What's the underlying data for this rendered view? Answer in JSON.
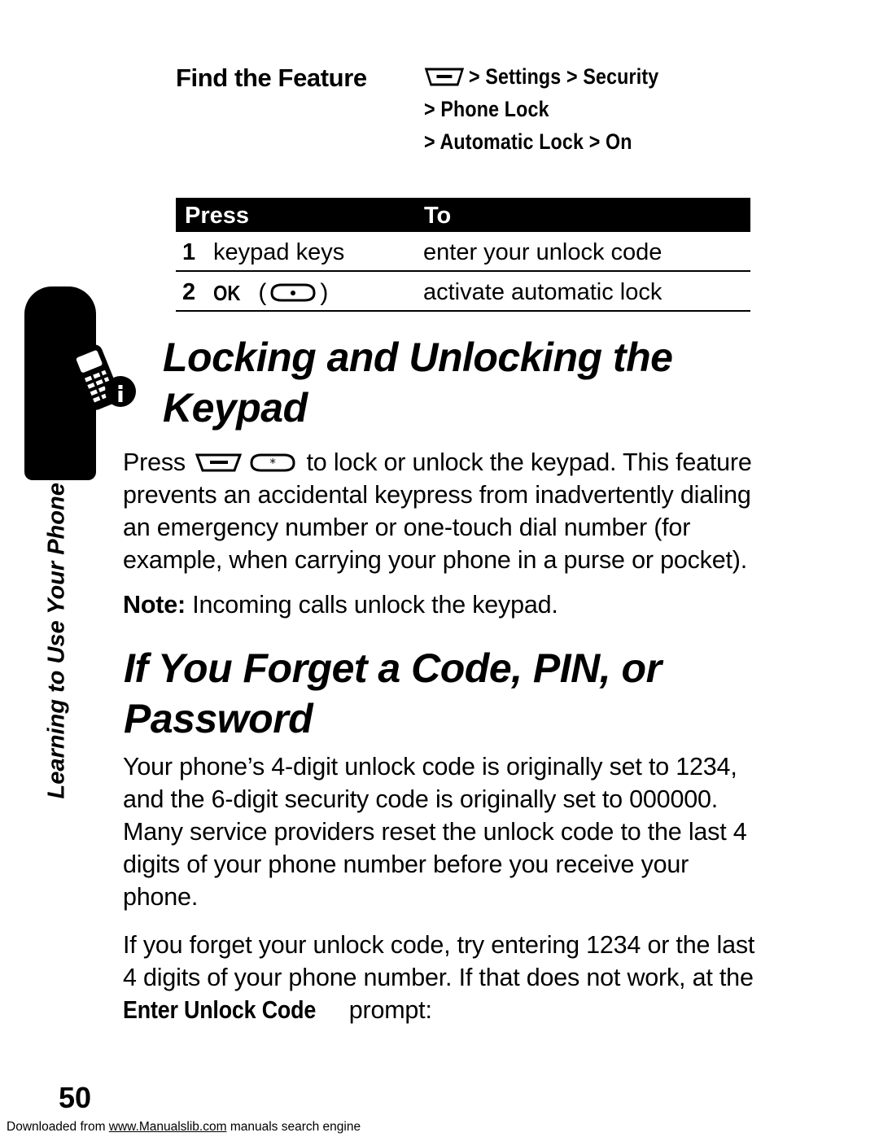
{
  "side_tab": {
    "label": "Learning to Use Your Phone"
  },
  "find_feature": {
    "label": "Find the Feature",
    "menu_icon": "menu-key-icon",
    "path_lines": [
      "> Settings > Security",
      "> Phone Lock",
      "> Automatic Lock > On"
    ]
  },
  "table": {
    "headers": [
      "Press",
      "To"
    ],
    "rows": [
      {
        "num": "1",
        "press": "keypad keys",
        "to": "enter your unlock code",
        "key_icon": null
      },
      {
        "num": "2",
        "press": "OK",
        "to": "activate automatic lock",
        "key_icon": "center-select-key-icon"
      }
    ]
  },
  "sections": [
    {
      "id": "locking",
      "icon": "phone-info-icon",
      "heading": "Locking and Unlocking the Keypad",
      "paragraphs": [
        {
          "id": "press-to-lock",
          "prefix": "Press ",
          "icons": [
            "menu-key-icon",
            "star-key-icon"
          ],
          "text": " to lock or unlock the keypad. This feature prevents an accidental keypress from inadvertently dialing an emergency number or one-touch dial number (for example, when carrying your phone in a purse or pocket)."
        },
        {
          "id": "note",
          "bold_lead": "Note:",
          "text": " Incoming calls unlock the keypad."
        }
      ]
    },
    {
      "id": "forget-code",
      "heading": "If You Forget a Code, PIN, or Password",
      "paragraphs": [
        {
          "id": "codes-default",
          "text": "Your phone’s 4-digit unlock code is originally set to 1234, and the 6-digit security code is originally set to 000000. Many service providers reset the unlock code to the last 4 digits of your phone number before you receive your phone."
        },
        {
          "id": "forget-instructions",
          "text": "If you forget your unlock code, try entering 1234 or the last 4 digits of your phone number. If that does not work, at the ",
          "prompt_label": "Enter Unlock Code",
          "text_after": " prompt:"
        }
      ]
    }
  ],
  "page_number": "50",
  "footer": {
    "prefix": "Downloaded from ",
    "link": "www.Manualslib.com",
    "suffix": " manuals search engine"
  }
}
